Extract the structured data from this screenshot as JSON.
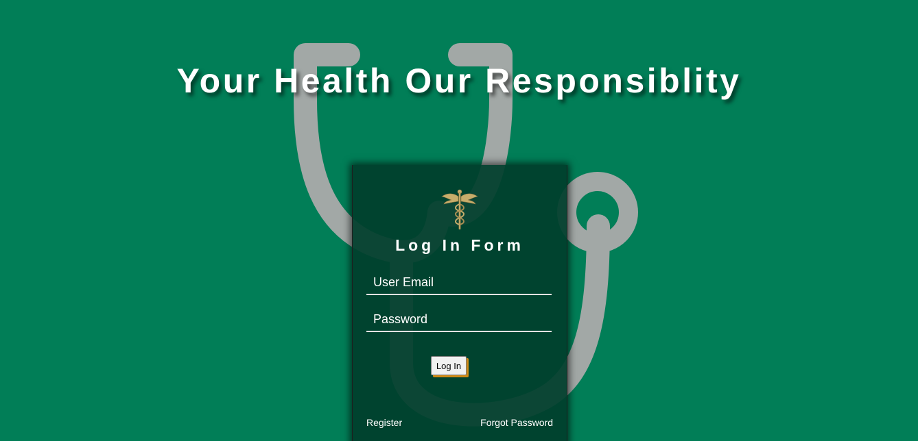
{
  "header": {
    "headline": "Your Health Our Responsiblity"
  },
  "login_form": {
    "logo_icon": "caduceus-icon",
    "title": "Log In Form",
    "email_placeholder": "User Email",
    "password_placeholder": "Password",
    "submit_label": "Log In",
    "register_link": "Register",
    "forgot_password_link": "Forgot Password"
  },
  "background": {
    "icon": "stethoscope-icon"
  },
  "colors": {
    "page_background": "#017e57",
    "card_background": "#003e2c",
    "button_accent": "#cf8a15",
    "watermark": "#b0b0b0"
  }
}
